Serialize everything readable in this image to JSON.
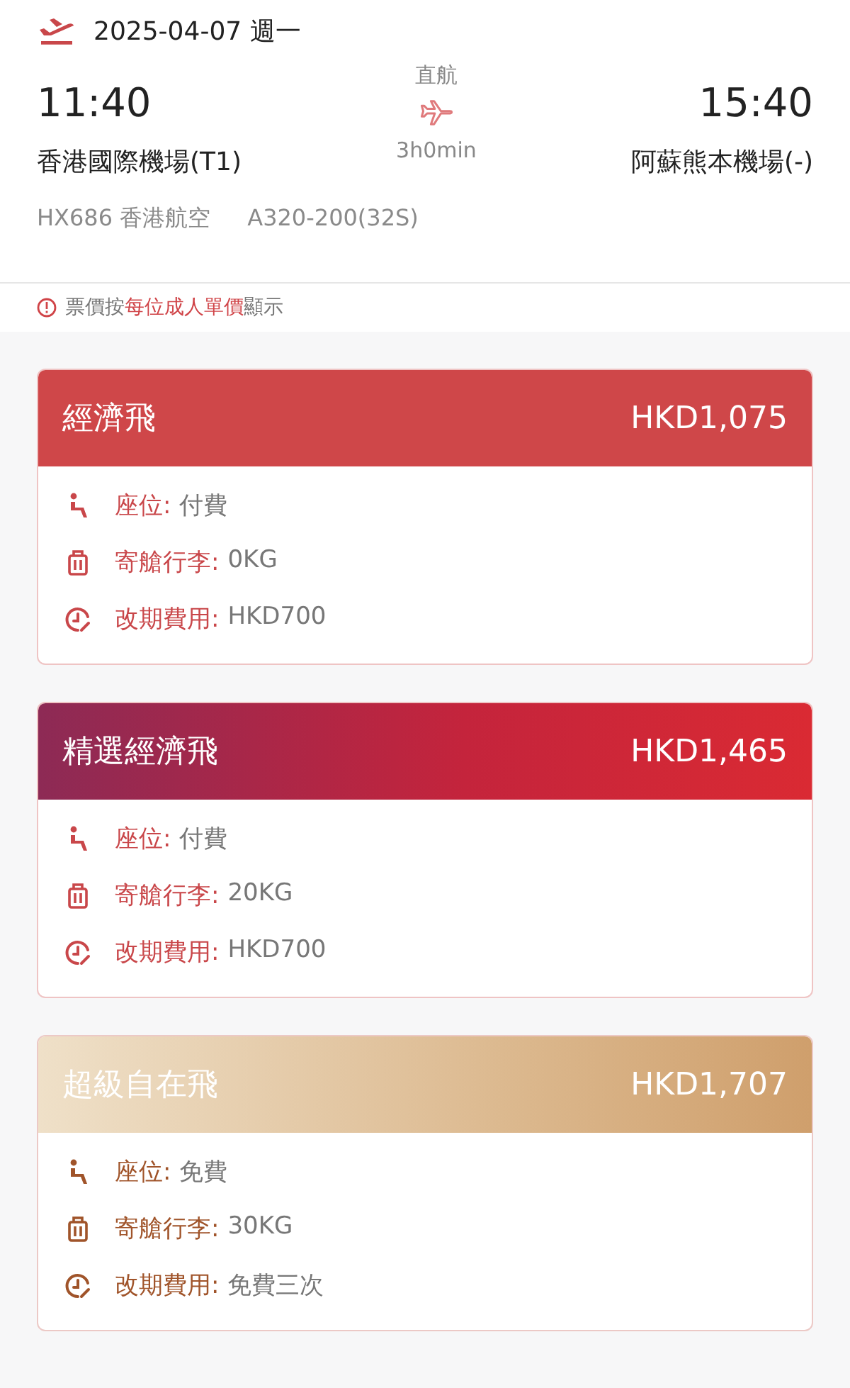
{
  "flight": {
    "date": "2025-04-07 週一",
    "departure": {
      "time": "11:40",
      "airport": "香港國際機場(T1)"
    },
    "stops": "直航",
    "duration": "3h0min",
    "arrival": {
      "time": "15:40",
      "airport": "阿蘇熊本機場(-)"
    },
    "flight_number": "HX686 香港航空",
    "aircraft": "A320-200(32S)"
  },
  "notice": "票價按**每位成人單價**顯示",
  "fares": [
    {
      "kind": "economy",
      "name": "經濟飛",
      "price": "HKD1,075",
      "features": [
        {
          "kind": "seat",
          "label": "座位:",
          "value": "付費"
        },
        {
          "kind": "baggage",
          "label": "寄艙行李:",
          "value": "0KG"
        },
        {
          "kind": "change",
          "label": "改期費用:",
          "value": "HKD700"
        }
      ]
    },
    {
      "kind": "select",
      "name": "精選經濟飛",
      "price": "HKD1,465",
      "features": [
        {
          "kind": "seat",
          "label": "座位:",
          "value": "付費"
        },
        {
          "kind": "baggage",
          "label": "寄艙行李:",
          "value": "20KG"
        },
        {
          "kind": "change",
          "label": "改期費用:",
          "value": "HKD700"
        }
      ]
    },
    {
      "kind": "super",
      "name": "超級自在飛",
      "price": "HKD1,707",
      "features": [
        {
          "kind": "seat",
          "label": "座位:",
          "value": "免費"
        },
        {
          "kind": "baggage",
          "label": "寄艙行李:",
          "value": "30KG"
        },
        {
          "kind": "change",
          "label": "改期費用:",
          "value": "免費三次"
        }
      ]
    }
  ]
}
